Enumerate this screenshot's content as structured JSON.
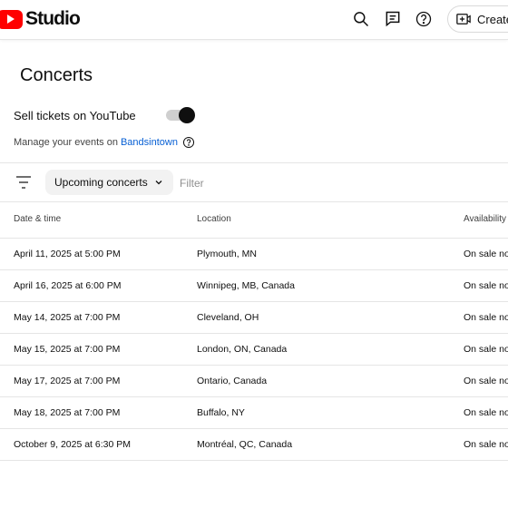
{
  "header": {
    "logo_text": "Studio",
    "create_label": "Create",
    "icons": [
      "search-icon",
      "feedback-icon",
      "help-icon",
      "create-video-icon"
    ]
  },
  "page": {
    "title": "Concerts",
    "sell_tickets_label": "Sell tickets on YouTube",
    "sell_tickets_enabled": true,
    "manage_text": "Manage your events on",
    "manage_link": "Bandsintown"
  },
  "filters": {
    "dropdown_value": "Upcoming concerts",
    "filter_placeholder": "Filter"
  },
  "table": {
    "columns": [
      "Date & time",
      "Location",
      "Availability"
    ],
    "rows": [
      {
        "date": "April 11, 2025 at 5:00 PM",
        "location": "Plymouth, MN",
        "availability": "On sale now"
      },
      {
        "date": "April 16, 2025 at 6:00 PM",
        "location": "Winnipeg, MB, Canada",
        "availability": "On sale now"
      },
      {
        "date": "May 14, 2025 at 7:00 PM",
        "location": "Cleveland, OH",
        "availability": "On sale now"
      },
      {
        "date": "May 15, 2025 at 7:00 PM",
        "location": "London, ON, Canada",
        "availability": "On sale now"
      },
      {
        "date": "May 17, 2025 at 7:00 PM",
        "location": "Ontario, Canada",
        "availability": "On sale now"
      },
      {
        "date": "May 18, 2025 at 7:00 PM",
        "location": "Buffalo, NY",
        "availability": "On sale now"
      },
      {
        "date": "October 9, 2025 at 6:30 PM",
        "location": "Montréal, QC, Canada",
        "availability": "On sale now"
      }
    ]
  },
  "colors": {
    "brand_red": "#ff0000",
    "link_blue": "#065fd4",
    "divider": "#e5e5e5"
  }
}
